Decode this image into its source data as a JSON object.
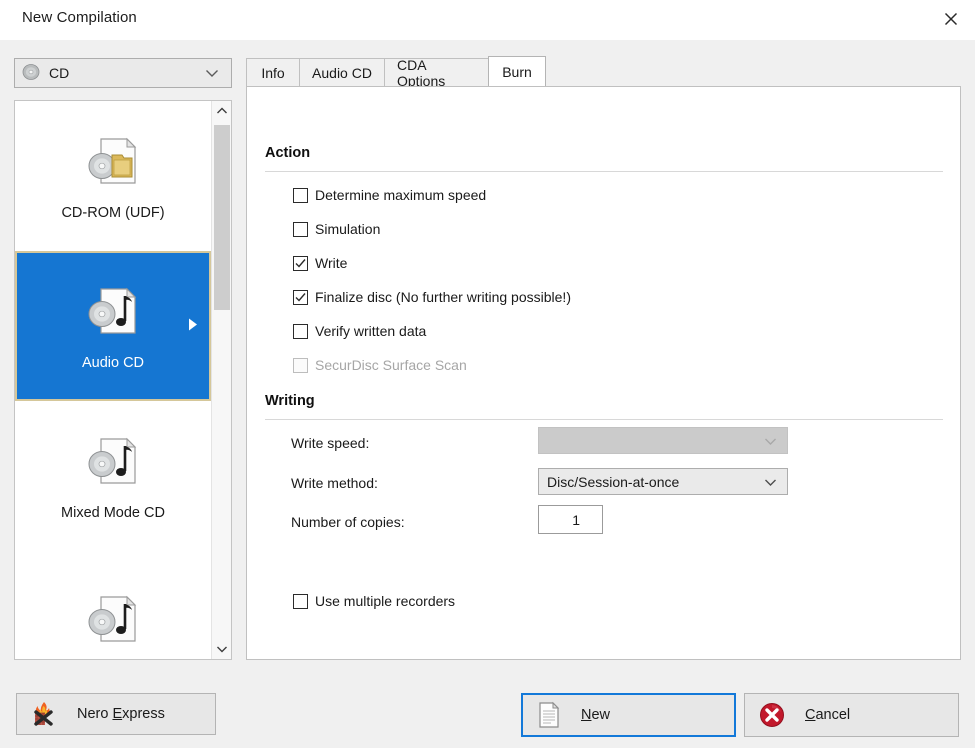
{
  "window": {
    "title": "New Compilation",
    "close_icon": "close-icon"
  },
  "device_selector": {
    "icon": "disc-icon",
    "value": "CD",
    "chevron_icon": "chevron-down-icon"
  },
  "compilation_types": {
    "items": [
      {
        "label": "CD-ROM (UDF)",
        "icon": "disc-folder-document-icon",
        "selected": false
      },
      {
        "label": "Audio CD",
        "icon": "disc-music-document-icon",
        "selected": true
      },
      {
        "label": "Mixed Mode CD",
        "icon": "disc-music-document-icon",
        "selected": false
      },
      {
        "label": "",
        "icon": "disc-music-document-icon",
        "selected": false
      }
    ],
    "selected_arrow_icon": "arrow-right-icon",
    "scrollbar": {
      "up_icon": "chevron-up-icon",
      "down_icon": "chevron-down-icon"
    }
  },
  "tabs": [
    {
      "label": "Info",
      "active": false
    },
    {
      "label": "Audio CD",
      "active": false
    },
    {
      "label": "CDA Options",
      "active": false
    },
    {
      "label": "Burn",
      "active": true
    }
  ],
  "burn_panel": {
    "action": {
      "title": "Action",
      "checkboxes": [
        {
          "label": "Determine maximum speed",
          "checked": false,
          "disabled": false
        },
        {
          "label": "Simulation",
          "checked": false,
          "disabled": false
        },
        {
          "label": "Write",
          "checked": true,
          "disabled": false
        },
        {
          "label": "Finalize disc (No further writing possible!)",
          "checked": true,
          "disabled": false
        },
        {
          "label": "Verify written data",
          "checked": false,
          "disabled": false
        },
        {
          "label": "SecurDisc Surface Scan",
          "checked": false,
          "disabled": true
        }
      ]
    },
    "writing": {
      "title": "Writing",
      "write_speed": {
        "label": "Write speed:",
        "value": "",
        "disabled": true
      },
      "write_method": {
        "label": "Write method:",
        "value": "Disc/Session-at-once",
        "disabled": false
      },
      "number_of_copies": {
        "label": "Number of copies:",
        "value": "1"
      },
      "use_multiple_recorders": {
        "label": "Use multiple recorders",
        "checked": false
      }
    }
  },
  "footer": {
    "nero_express": {
      "label_pre": "Nero ",
      "accel": "E",
      "label_post": "xpress",
      "icon": "flame-disc-icon"
    },
    "new": {
      "accel": "N",
      "label_post": "ew",
      "icon": "document-icon",
      "focused": true
    },
    "cancel": {
      "accel": "C",
      "label_post": "ancel",
      "icon": "cancel-circle-icon"
    }
  },
  "colors": {
    "selection_blue": "#1576d2",
    "focus_blue": "#1379d9",
    "dialog_bg": "#f0f0f0",
    "panel_bg": "#ffffff",
    "disabled_text": "#a6a6a6"
  }
}
